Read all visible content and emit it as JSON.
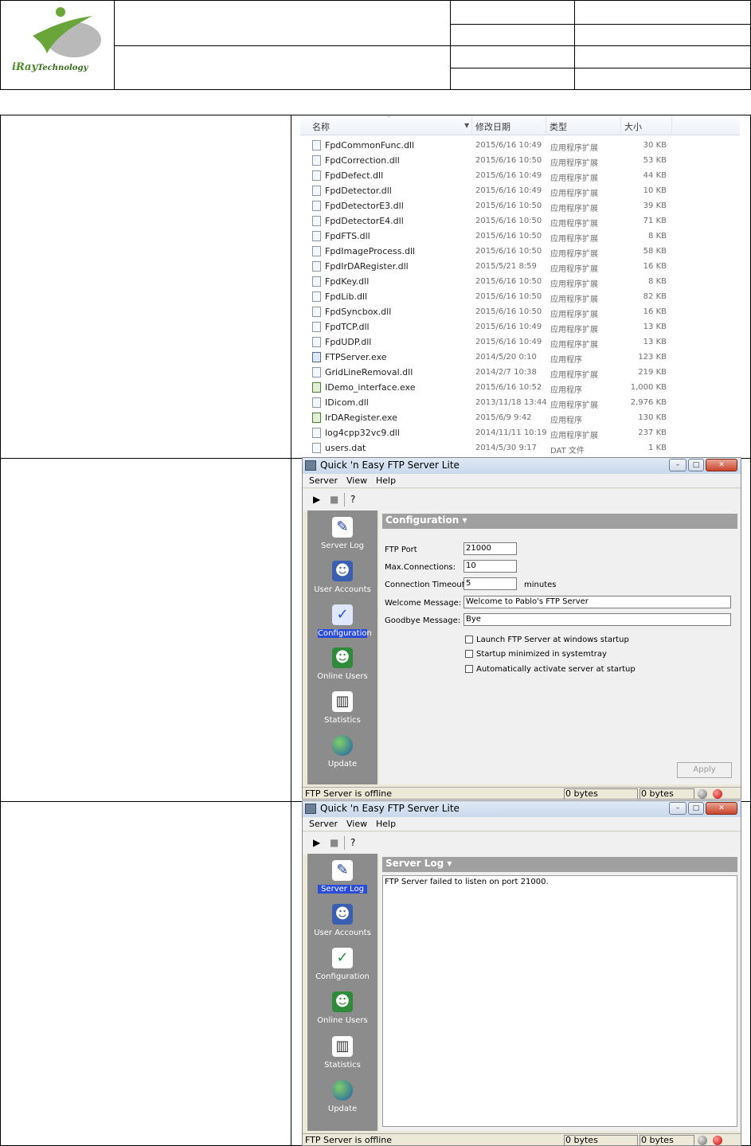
{
  "logo": {
    "brand": "iRay",
    "brand_suffix": "Technology"
  },
  "file_list": {
    "columns": {
      "name": "名称",
      "modified": "修改日期",
      "type": "类型",
      "size": "大小"
    },
    "rows": [
      {
        "name": "FpdCommonFunc.dll",
        "modified": "2015/6/16 10:49",
        "type": "应用程序扩展",
        "size": "30 KB",
        "icon": "dll-file-icon"
      },
      {
        "name": "FpdCorrection.dll",
        "modified": "2015/6/16 10:50",
        "type": "应用程序扩展",
        "size": "53 KB",
        "icon": "dll-file-icon"
      },
      {
        "name": "FpdDefect.dll",
        "modified": "2015/6/16 10:49",
        "type": "应用程序扩展",
        "size": "44 KB",
        "icon": "dll-file-icon"
      },
      {
        "name": "FpdDetector.dll",
        "modified": "2015/6/16 10:49",
        "type": "应用程序扩展",
        "size": "10 KB",
        "icon": "dll-file-icon"
      },
      {
        "name": "FpdDetectorE3.dll",
        "modified": "2015/6/16 10:50",
        "type": "应用程序扩展",
        "size": "39 KB",
        "icon": "dll-file-icon"
      },
      {
        "name": "FpdDetectorE4.dll",
        "modified": "2015/6/16 10:50",
        "type": "应用程序扩展",
        "size": "71 KB",
        "icon": "dll-file-icon"
      },
      {
        "name": "FpdFTS.dll",
        "modified": "2015/6/16 10:50",
        "type": "应用程序扩展",
        "size": "8 KB",
        "icon": "dll-file-icon"
      },
      {
        "name": "FpdImageProcess.dll",
        "modified": "2015/6/16 10:50",
        "type": "应用程序扩展",
        "size": "58 KB",
        "icon": "dll-file-icon"
      },
      {
        "name": "FpdIrDARegister.dll",
        "modified": "2015/5/21 8:59",
        "type": "应用程序扩展",
        "size": "16 KB",
        "icon": "dll-file-icon"
      },
      {
        "name": "FpdKey.dll",
        "modified": "2015/6/16 10:50",
        "type": "应用程序扩展",
        "size": "8 KB",
        "icon": "dll-file-icon"
      },
      {
        "name": "FpdLib.dll",
        "modified": "2015/6/16 10:50",
        "type": "应用程序扩展",
        "size": "82 KB",
        "icon": "dll-file-icon"
      },
      {
        "name": "FpdSyncbox.dll",
        "modified": "2015/6/16 10:50",
        "type": "应用程序扩展",
        "size": "16 KB",
        "icon": "dll-file-icon"
      },
      {
        "name": "FpdTCP.dll",
        "modified": "2015/6/16 10:49",
        "type": "应用程序扩展",
        "size": "13 KB",
        "icon": "dll-file-icon"
      },
      {
        "name": "FpdUDP.dll",
        "modified": "2015/6/16 10:49",
        "type": "应用程序扩展",
        "size": "13 KB",
        "icon": "dll-file-icon"
      },
      {
        "name": "FTPServer.exe",
        "modified": "2014/5/20 0:10",
        "type": "应用程序",
        "size": "123 KB",
        "icon": "ftp-server-exe-icon"
      },
      {
        "name": "GridLineRemoval.dll",
        "modified": "2014/2/7 10:38",
        "type": "应用程序扩展",
        "size": "219 KB",
        "icon": "dll-file-icon"
      },
      {
        "name": "IDemo_interface.exe",
        "modified": "2015/6/16 10:52",
        "type": "应用程序",
        "size": "1,000 KB",
        "icon": "app-exe-icon"
      },
      {
        "name": "IDicom.dll",
        "modified": "2013/11/18 13:44",
        "type": "应用程序扩展",
        "size": "2,976 KB",
        "icon": "dll-file-icon"
      },
      {
        "name": "IrDARegister.exe",
        "modified": "2015/6/9 9:42",
        "type": "应用程序",
        "size": "130 KB",
        "icon": "app-exe-icon"
      },
      {
        "name": "log4cpp32vc9.dll",
        "modified": "2014/11/11 10:19",
        "type": "应用程序扩展",
        "size": "237 KB",
        "icon": "dll-file-icon"
      },
      {
        "name": "users.dat",
        "modified": "2014/5/30 9:17",
        "type": "DAT 文件",
        "size": "1 KB",
        "icon": "dat-file-icon"
      }
    ]
  },
  "ftp_app": {
    "title": "Quick 'n Easy FTP Server Lite",
    "menu": [
      "Server",
      "View",
      "Help"
    ],
    "nav": [
      {
        "label": "Server Log",
        "icon": "server-log-icon"
      },
      {
        "label": "User Accounts",
        "icon": "user-accounts-icon"
      },
      {
        "label": "Configuration",
        "icon": "configuration-icon"
      },
      {
        "label": "Online Users",
        "icon": "online-users-icon"
      },
      {
        "label": "Statistics",
        "icon": "statistics-icon"
      },
      {
        "label": "Update",
        "icon": "globe-icon"
      }
    ],
    "status": {
      "text": "FTP Server is offline",
      "received": "0 bytes received",
      "sent": "0 bytes sent"
    }
  },
  "config_window": {
    "section_title": "Configuration ▾",
    "ftp_port_label": "FTP Port",
    "ftp_port_value": "21000",
    "max_conn_label": "Max.Connections:",
    "max_conn_value": "10",
    "timeout_label": "Connection Timeout:",
    "timeout_value": "5",
    "timeout_unit": "minutes",
    "welcome_label": "Welcome Message:",
    "welcome_value": "Welcome to Pablo's FTP Server",
    "goodbye_label": "Goodbye Message:",
    "goodbye_value": "Bye",
    "checkboxes": [
      "Launch FTP Server at windows startup",
      "Startup minimized in systemtray",
      "Automatically activate server at startup"
    ],
    "apply_label": "Apply"
  },
  "log_window": {
    "section_title": "Server Log ▾",
    "log_text": "FTP Server failed to listen on port 21000."
  }
}
